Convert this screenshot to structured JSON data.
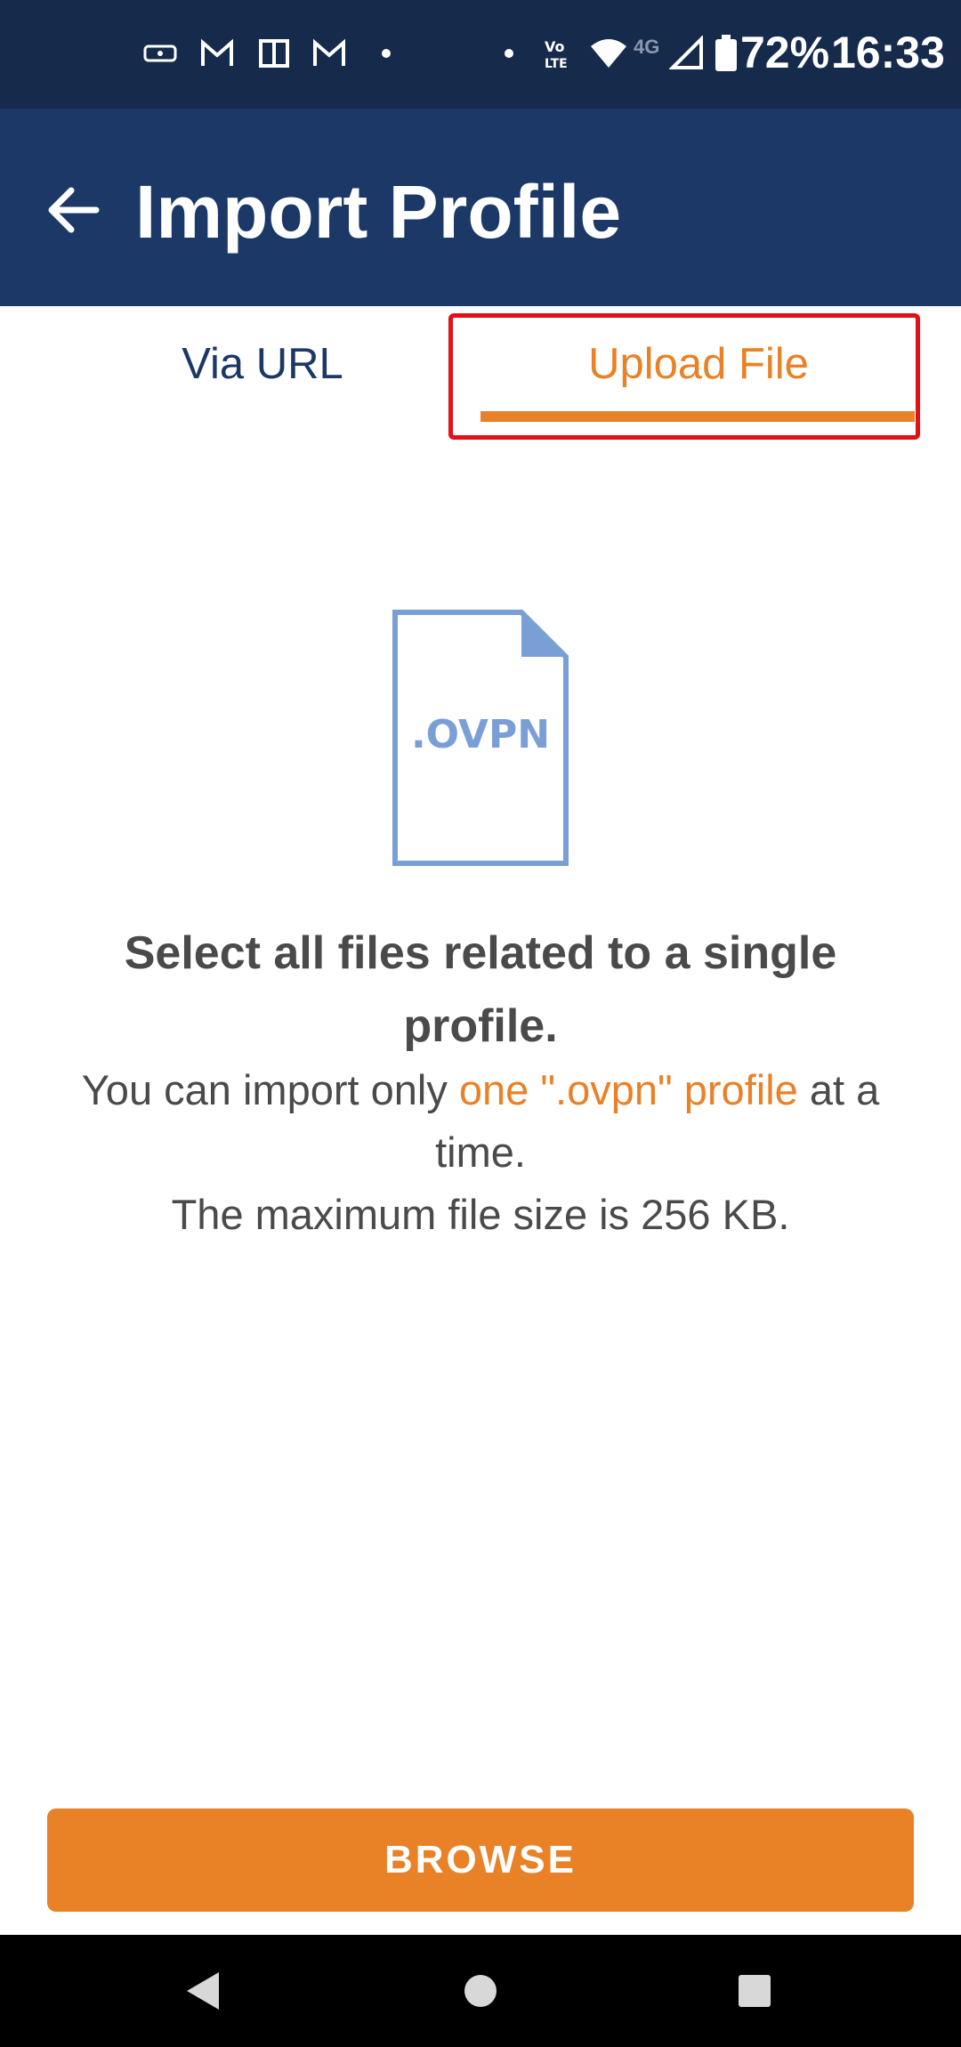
{
  "status_bar": {
    "battery": "72%",
    "time": "16:33",
    "network": "4G",
    "icons": [
      "vpn-key-icon",
      "gmail-icon",
      "book-icon",
      "gmail-icon",
      "dot-icon",
      "dot-icon",
      "volte-icon",
      "wifi-icon",
      "signal-icon",
      "battery-icon"
    ]
  },
  "app_bar": {
    "title": "Import Profile",
    "back_icon": "arrow-left-icon"
  },
  "tabs": [
    {
      "label": "Via URL",
      "selected": false
    },
    {
      "label": "Upload File",
      "selected": true
    }
  ],
  "illustration": {
    "file_ext": ".OVPN"
  },
  "content": {
    "headline": "Select all files related to a single profile.",
    "body_before": "You can import only ",
    "body_highlight": "one \".ovpn\" profile",
    "body_after": " at a time.",
    "max_size": "The maximum file size is 256 KB."
  },
  "browse_button": {
    "label": "BROWSE"
  },
  "colors": {
    "status_bar_bg": "#162a4b",
    "app_bar_bg": "#1b3866",
    "accent": "#e98127",
    "highlight_border": "#e3101a",
    "illustration": "#7a9fd6",
    "text": "#4a4a4a"
  }
}
